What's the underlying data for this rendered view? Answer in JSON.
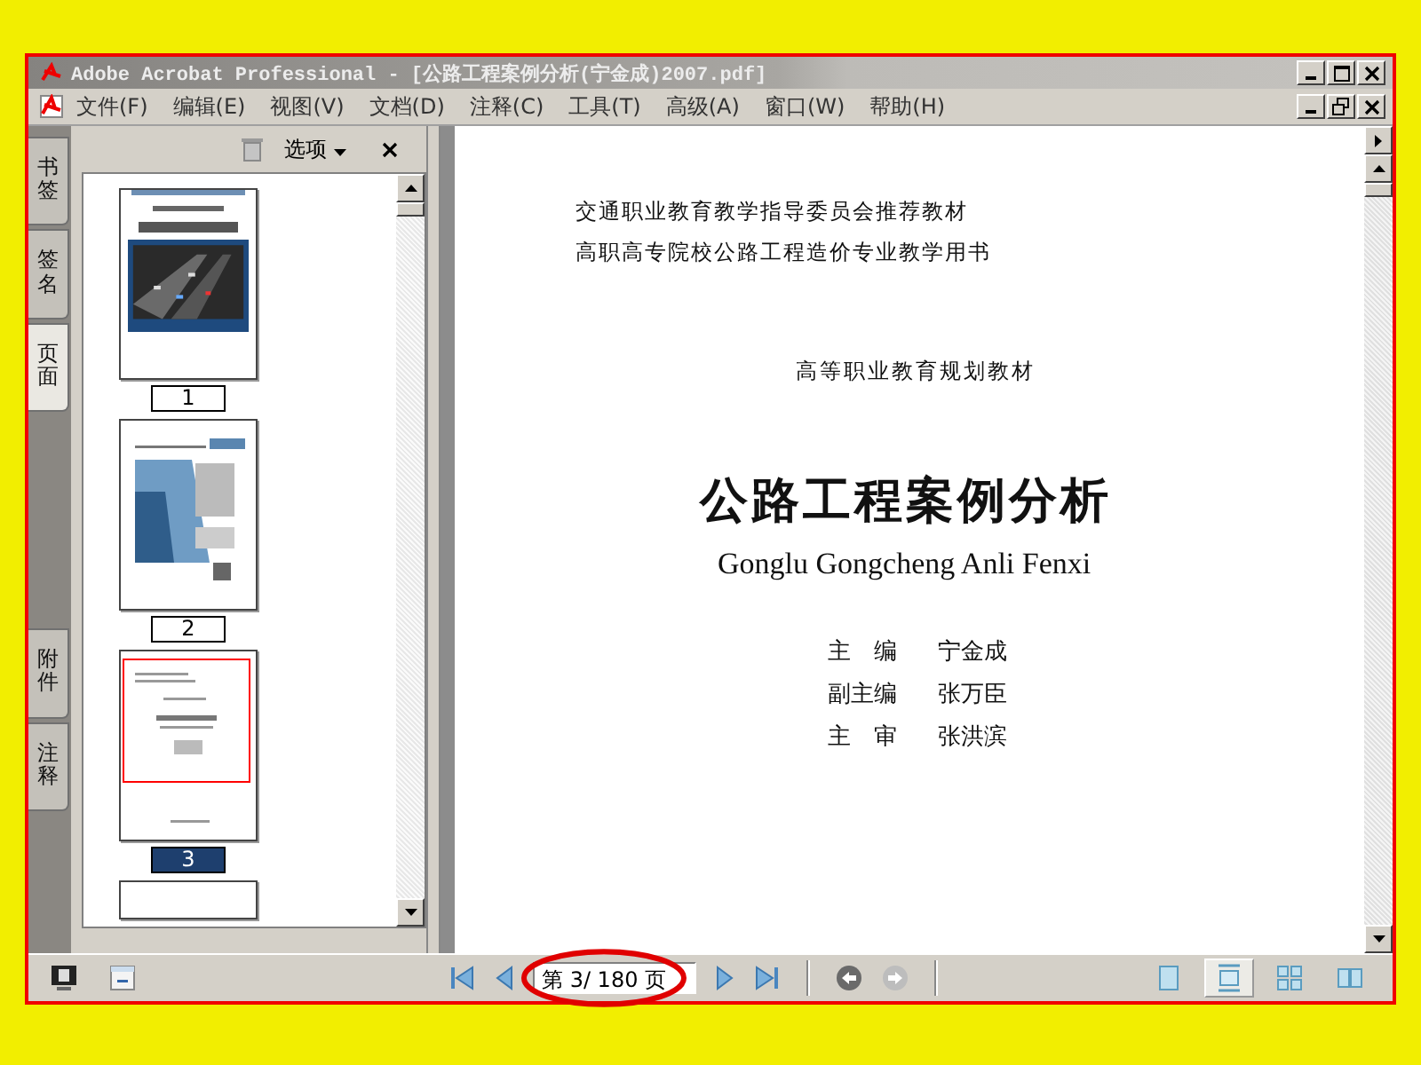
{
  "window": {
    "title": "Adobe Acrobat Professional - [公路工程案例分析(宁金成)2007.pdf]"
  },
  "menu": [
    {
      "label": "文件(F)"
    },
    {
      "label": "编辑(E)"
    },
    {
      "label": "视图(V)"
    },
    {
      "label": "文档(D)"
    },
    {
      "label": "注释(C)"
    },
    {
      "label": "工具(T)"
    },
    {
      "label": "高级(A)"
    },
    {
      "label": "窗口(W)"
    },
    {
      "label": "帮助(H)"
    }
  ],
  "side_tabs_top": [
    {
      "label": "书签",
      "selected": false
    },
    {
      "label": "签名",
      "selected": false
    },
    {
      "label": "页面",
      "selected": true
    }
  ],
  "side_tabs_bottom": [
    {
      "label": "附件",
      "selected": false
    },
    {
      "label": "注释",
      "selected": false
    }
  ],
  "panel": {
    "options_label": "选项",
    "thumbnails": [
      {
        "kind": "cover",
        "label": "1",
        "selected": false
      },
      {
        "kind": "copyright",
        "label": "2",
        "selected": false
      },
      {
        "kind": "title-page",
        "label": "3",
        "selected": true
      }
    ]
  },
  "document": {
    "header_lines": [
      "交通职业教育教学指导委员会推荐教材",
      "高职高专院校公路工程造价专业教学用书"
    ],
    "series": "高等职业教育规划教材",
    "title": "公路工程案例分析",
    "subtitle": "Gonglu Gongcheng Anli Fenxi",
    "credits": [
      {
        "role": "主　编",
        "name": "宁金成"
      },
      {
        "role": "副主编",
        "name": "张万臣"
      },
      {
        "role": "主　审",
        "name": "张洪滨"
      }
    ]
  },
  "toolbar": {
    "page_field": "第 3/ 180 页",
    "view_nav": [
      {
        "kind": "back",
        "disabled": false
      },
      {
        "kind": "forward",
        "disabled": true
      }
    ],
    "layouts": [
      {
        "kind": "single",
        "selected": false
      },
      {
        "kind": "continuous",
        "selected": true
      },
      {
        "kind": "continuous-facing",
        "selected": false
      },
      {
        "kind": "facing",
        "selected": false
      }
    ]
  }
}
